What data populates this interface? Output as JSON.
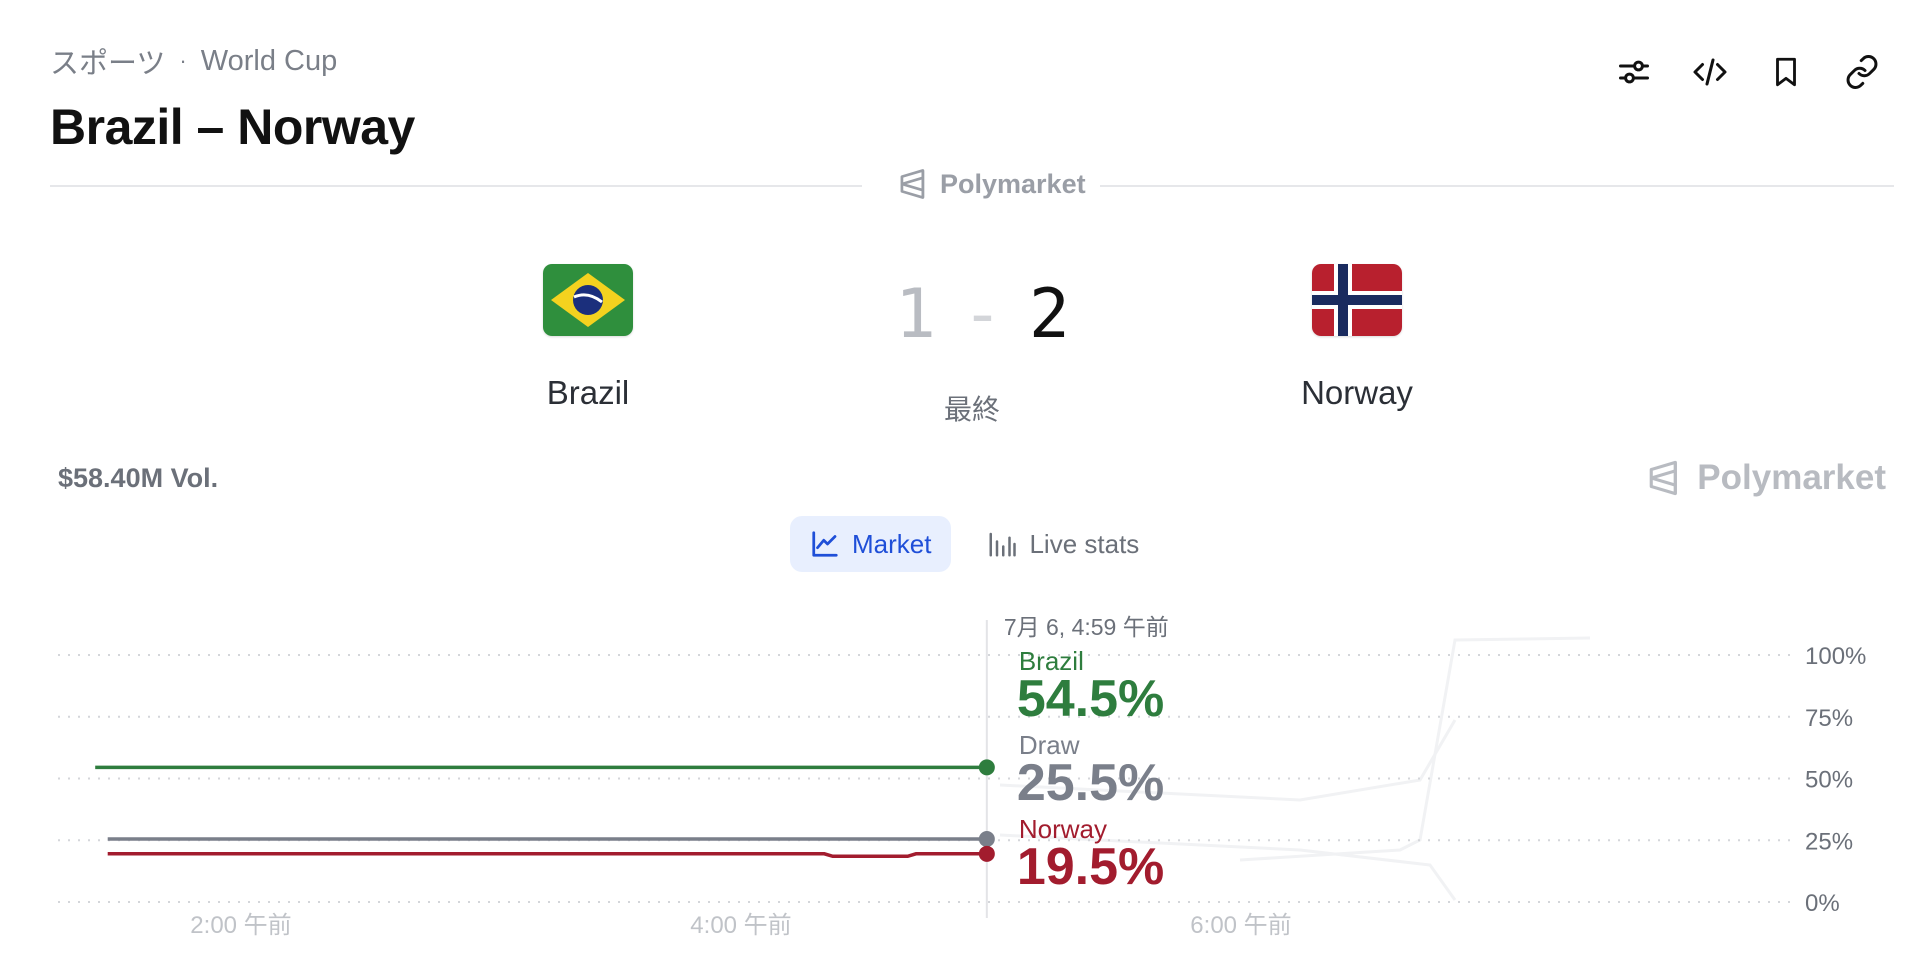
{
  "breadcrumb": {
    "category": "スポーツ",
    "separator": "·",
    "league": "World Cup"
  },
  "title": "Brazil – Norway",
  "toolbar": {
    "icons": [
      "sliders-icon",
      "code-icon",
      "bookmark-icon",
      "link-icon"
    ]
  },
  "brand": {
    "name": "Polymarket"
  },
  "match": {
    "home": {
      "name": "Brazil",
      "score": "1",
      "flag": "brazil-flag-icon"
    },
    "separator": "-",
    "away": {
      "name": "Norway",
      "score": "2",
      "flag": "norway-flag-icon"
    },
    "status": "最終"
  },
  "volume": "$58.40M Vol.",
  "tabs": [
    {
      "label": "Market",
      "icon": "line-chart-icon",
      "active": true
    },
    {
      "label": "Live stats",
      "icon": "bar-stats-icon",
      "active": false
    }
  ],
  "colors": {
    "brazil": "#2e7d3e",
    "draw": "#7a7f8a",
    "norway": "#a21c2e",
    "accent": "#1f4fd8"
  },
  "chart_data": {
    "type": "line",
    "hover_label": "7月 6, 4:59 午前",
    "x_ticks": [
      "2:00 午前",
      "4:00 午前",
      "6:00 午前"
    ],
    "y_ticks": [
      "100%",
      "75%",
      "50%",
      "25%",
      "0%"
    ],
    "ylim": [
      0,
      100
    ],
    "grid": true,
    "series": [
      {
        "name": "Brazil",
        "value_label": "54.5%",
        "color": "#2e7d3e",
        "points": [
          [
            "1:25",
            54.5
          ],
          [
            "4:59",
            54.5
          ]
        ]
      },
      {
        "name": "Draw",
        "value_label": "25.5%",
        "color": "#7a7f8a",
        "points": [
          [
            "1:28",
            25.5
          ],
          [
            "4:59",
            25.5
          ]
        ]
      },
      {
        "name": "Norway",
        "value_label": "19.5%",
        "color": "#a21c2e",
        "points": [
          [
            "1:28",
            19.5
          ],
          [
            "4:20",
            19.5
          ],
          [
            "4:22",
            18.5
          ],
          [
            "4:40",
            18.5
          ],
          [
            "4:42",
            19.5
          ],
          [
            "4:59",
            19.5
          ]
        ]
      }
    ]
  }
}
